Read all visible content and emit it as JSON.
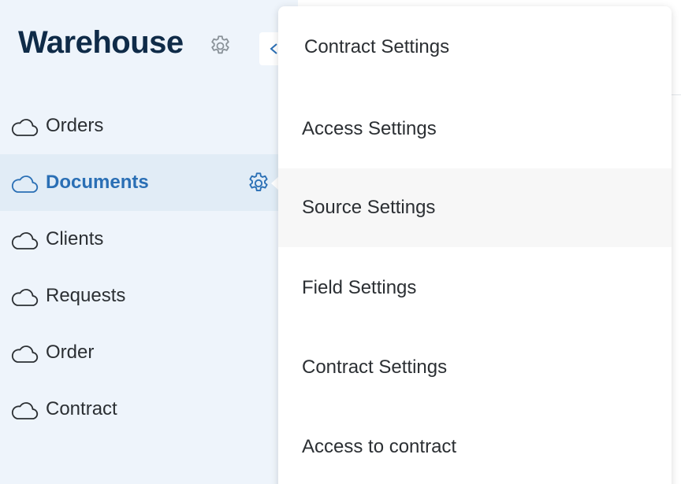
{
  "app": {
    "title": "Warehouse"
  },
  "icons": {
    "title_settings": "gear-icon",
    "collapse": "chevron-left-icon",
    "nav": "cloud-icon",
    "row_settings": "gear-icon"
  },
  "colors": {
    "accent": "#2a6fb5",
    "title": "#0f2b48",
    "sidebar_bg": "#eef4fb",
    "active_bg": "#e1ecf6",
    "hover_bg": "#f7f7f7"
  },
  "sidebar": {
    "items": [
      {
        "label": "Orders",
        "active": false
      },
      {
        "label": "Documents",
        "active": true
      },
      {
        "label": "Clients",
        "active": false
      },
      {
        "label": "Requests",
        "active": false
      },
      {
        "label": "Order",
        "active": false
      },
      {
        "label": "Contract",
        "active": false
      }
    ]
  },
  "dropdown": {
    "items": [
      {
        "label": "Contract Settings"
      },
      {
        "label": "Access Settings"
      },
      {
        "label": "Source Settings",
        "highlighted": true
      },
      {
        "label": "Field Settings"
      },
      {
        "label": "Contract Settings"
      },
      {
        "label": "Access to contract"
      }
    ]
  }
}
